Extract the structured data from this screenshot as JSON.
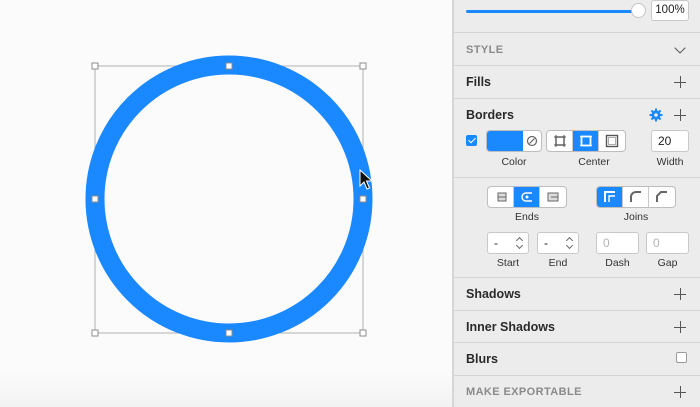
{
  "canvas": {
    "shape": {
      "type": "ring",
      "border_color": "#1a88ff",
      "selection_handle_color": "#ffffff"
    }
  },
  "inspector": {
    "opacity_percent": "100%",
    "opacity_value": 1.0,
    "style_section": {
      "title": "STYLE"
    },
    "fills": {
      "title": "Fills"
    },
    "borders": {
      "title": "Borders",
      "enabled": true,
      "color_hex": "#1a88ff",
      "color_label": "Color",
      "position_label": "Center",
      "position_options": [
        "Inside",
        "Center",
        "Outside"
      ],
      "position_selected": "Center",
      "width_value": "20",
      "width_label": "Width"
    },
    "border_options": {
      "ends_label": "Ends",
      "ends_selected_index": 1,
      "joins_label": "Joins",
      "joins_selected_index": 0,
      "start_value": "-",
      "start_label": "Start",
      "end_value": "-",
      "end_label": "End",
      "dash_placeholder": "0",
      "dash_label": "Dash",
      "gap_placeholder": "0",
      "gap_label": "Gap"
    },
    "shadows": {
      "title": "Shadows"
    },
    "inner_shadows": {
      "title": "Inner Shadows"
    },
    "blurs": {
      "title": "Blurs",
      "checked": false
    },
    "export": {
      "title": "MAKE EXPORTABLE"
    }
  },
  "icons": [
    "cursor-arrow-icon",
    "gear-icon",
    "plus-icon",
    "chevron-down-icon",
    "checkbox-icon",
    "color-picker-icon",
    "border-inside-icon",
    "border-center-icon",
    "border-outside-icon",
    "butt-end-icon",
    "round-end-icon",
    "square-end-icon",
    "miter-join-icon",
    "round-join-icon",
    "bevel-join-icon"
  ]
}
